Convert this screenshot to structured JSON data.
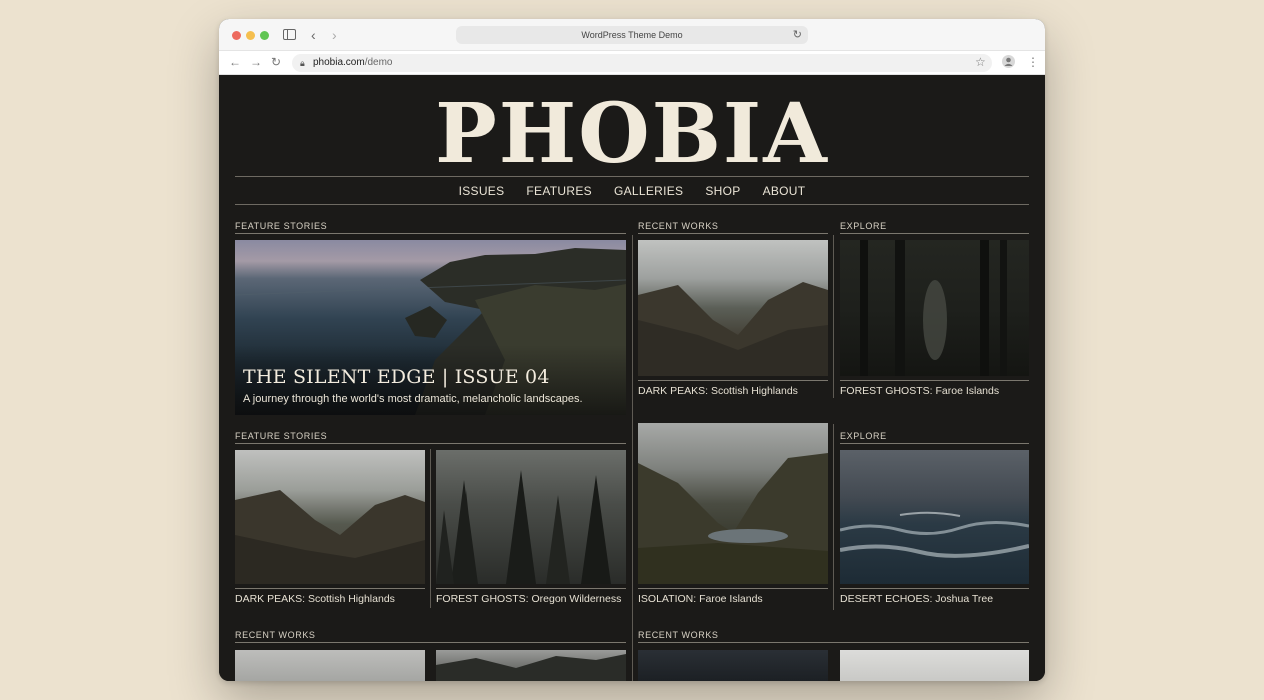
{
  "browser": {
    "tab_title": "WordPress Theme Demo",
    "url_host": "phobia.com",
    "url_path": "/demo",
    "colors": {
      "close": "#ed6a5e",
      "minimize": "#f5bf4f",
      "maximize": "#61c554"
    }
  },
  "site": {
    "logo": "PHOBIA",
    "nav": [
      "ISSUES",
      "FEATURES",
      "GALLERIES",
      "SHOP",
      "ABOUT"
    ]
  },
  "sections": {
    "feature_1": "FEATURE STORIES",
    "recent_1": "RECENT WORKS",
    "explore_1": "EXPLORE",
    "feature_2": "FEATURE STORIES",
    "explore_2": "EXPLORE",
    "recent_2": "RECENT WORKS",
    "recent_3": "RECENT WORKS"
  },
  "hero": {
    "title": "THE SILENT EDGE | ISSUE 04",
    "subtitle": "A journey through the world's most dramatic, melancholic landscapes."
  },
  "cards": {
    "c1": "DARK PEAKS: Scottish Highlands",
    "c2": "FOREST GHOSTS: Faroe Islands",
    "c3": "DARK PEAKS: Scottish Highlands",
    "c4": "FOREST GHOSTS: Oregon Wilderness",
    "c5": "ISOLATION: Faroe Islands",
    "c6": "DESERT ECHOES: Joshua Tree"
  }
}
